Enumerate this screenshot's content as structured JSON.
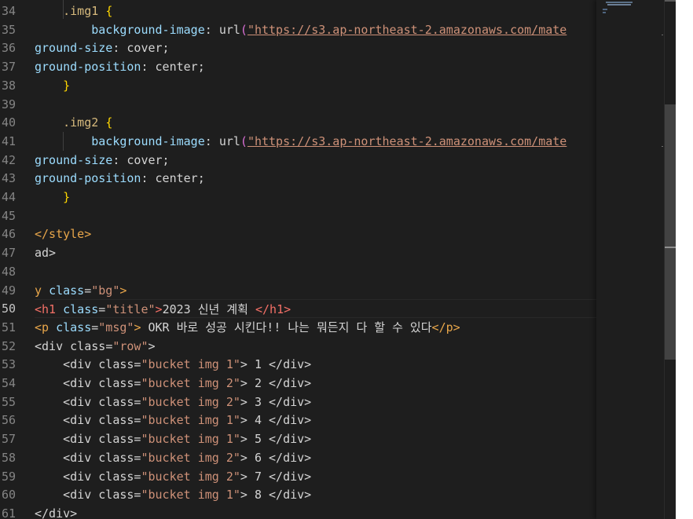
{
  "editor": {
    "language": "html",
    "active_line": "50",
    "colors": {
      "background": "#1e1e1e",
      "line_number": "#858585",
      "line_number_active": "#c6c6c6",
      "text": "#d4d4d4",
      "tag": "#808080",
      "tag_name": "#569cd6",
      "attribute": "#9cdcfe",
      "string": "#ce9178",
      "selector": "#d7ba7d",
      "style_tag": "#e8a64a",
      "paren": "#da70d6",
      "brace": "#ffd700"
    },
    "lines": [
      {
        "num": "34",
        "tokens": [
          {
            "t": "    .img1 ",
            "c": "selector"
          },
          {
            "t": "{",
            "c": "brace"
          }
        ]
      },
      {
        "num": "35",
        "tokens": [
          {
            "t": "        ",
            "c": "text"
          },
          {
            "t": "background-image",
            "c": "attribute"
          },
          {
            "t": ": ",
            "c": "text"
          },
          {
            "t": "url",
            "c": "text"
          },
          {
            "t": "(",
            "c": "paren"
          },
          {
            "t": "\"https://s3.ap-northeast-2.amazonaws.com/mate",
            "c": "string",
            "u": true
          }
        ]
      },
      {
        "num": "36",
        "tokens": [
          {
            "t": "ground-size",
            "c": "attribute"
          },
          {
            "t": ": cover;",
            "c": "text"
          }
        ]
      },
      {
        "num": "37",
        "tokens": [
          {
            "t": "ground-position",
            "c": "attribute"
          },
          {
            "t": ": center;",
            "c": "text"
          }
        ]
      },
      {
        "num": "38",
        "tokens": [
          {
            "t": "    ",
            "c": "text"
          },
          {
            "t": "}",
            "c": "brace"
          }
        ]
      },
      {
        "num": "39",
        "tokens": []
      },
      {
        "num": "40",
        "tokens": [
          {
            "t": "    .img2 ",
            "c": "selector"
          },
          {
            "t": "{",
            "c": "brace"
          }
        ]
      },
      {
        "num": "41",
        "tokens": [
          {
            "t": "        ",
            "c": "text"
          },
          {
            "t": "background-image",
            "c": "attribute"
          },
          {
            "t": ": ",
            "c": "text"
          },
          {
            "t": "url",
            "c": "text"
          },
          {
            "t": "(",
            "c": "paren"
          },
          {
            "t": "\"https://s3.ap-northeast-2.amazonaws.com/mate",
            "c": "string",
            "u": true
          }
        ]
      },
      {
        "num": "42",
        "tokens": [
          {
            "t": "ground-size",
            "c": "attribute"
          },
          {
            "t": ": cover;",
            "c": "text"
          }
        ]
      },
      {
        "num": "43",
        "tokens": [
          {
            "t": "ground-position",
            "c": "attribute"
          },
          {
            "t": ": center;",
            "c": "text"
          }
        ]
      },
      {
        "num": "44",
        "tokens": [
          {
            "t": "    ",
            "c": "text"
          },
          {
            "t": "}",
            "c": "brace"
          }
        ]
      },
      {
        "num": "45",
        "tokens": []
      },
      {
        "num": "46",
        "tokens": [
          {
            "t": "</style>",
            "c": "style_tag"
          }
        ]
      },
      {
        "num": "47",
        "tokens": [
          {
            "t": "ad>",
            "c": "text"
          }
        ]
      },
      {
        "num": "48",
        "tokens": []
      },
      {
        "num": "49",
        "tokens": [
          {
            "t": "y ",
            "c": "style_tag"
          },
          {
            "t": "class",
            "c": "attribute"
          },
          {
            "t": "=",
            "c": "text"
          },
          {
            "t": "\"bg\"",
            "c": "string"
          },
          {
            "t": ">",
            "c": "style_tag"
          }
        ]
      },
      {
        "num": "50",
        "tokens": [
          {
            "t": "<h1 ",
            "c": "tag_red"
          },
          {
            "t": "class",
            "c": "attribute_red"
          },
          {
            "t": "=",
            "c": "text"
          },
          {
            "t": "\"title\"",
            "c": "string"
          },
          {
            "t": ">",
            "c": "tag_red"
          },
          {
            "t": "2023 신년 계획 ",
            "c": "text"
          },
          {
            "t": "</h1>",
            "c": "tag_red"
          }
        ]
      },
      {
        "num": "51",
        "tokens": [
          {
            "t": "<p ",
            "c": "style_tag"
          },
          {
            "t": "class",
            "c": "attribute"
          },
          {
            "t": "=",
            "c": "text"
          },
          {
            "t": "\"msg\"",
            "c": "string"
          },
          {
            "t": ">",
            "c": "style_tag"
          },
          {
            "t": " OKR 바로 성공 시킨다!! 나는 뭐든지 다 할 수 있다",
            "c": "text"
          },
          {
            "t": "</p>",
            "c": "style_tag"
          }
        ]
      },
      {
        "num": "52",
        "tokens": [
          {
            "t": "<div ",
            "c": "text"
          },
          {
            "t": "class",
            "c": "text"
          },
          {
            "t": "=",
            "c": "text"
          },
          {
            "t": "\"row\"",
            "c": "string"
          },
          {
            "t": ">",
            "c": "text"
          }
        ]
      },
      {
        "num": "53",
        "tokens": [
          {
            "t": "    <div class=",
            "c": "text"
          },
          {
            "t": "\"bucket img 1\"",
            "c": "string"
          },
          {
            "t": "> 1 </div>",
            "c": "text"
          }
        ]
      },
      {
        "num": "54",
        "tokens": [
          {
            "t": "    <div class=",
            "c": "text"
          },
          {
            "t": "\"bucket img 2\"",
            "c": "string"
          },
          {
            "t": "> 2 </div>",
            "c": "text"
          }
        ]
      },
      {
        "num": "55",
        "tokens": [
          {
            "t": "    <div class=",
            "c": "text"
          },
          {
            "t": "\"bucket img 2\"",
            "c": "string"
          },
          {
            "t": "> 3 </div>",
            "c": "text"
          }
        ]
      },
      {
        "num": "56",
        "tokens": [
          {
            "t": "    <div class=",
            "c": "text"
          },
          {
            "t": "\"bucket img 1\"",
            "c": "string"
          },
          {
            "t": "> 4 </div>",
            "c": "text"
          }
        ]
      },
      {
        "num": "57",
        "tokens": [
          {
            "t": "    <div class=",
            "c": "text"
          },
          {
            "t": "\"bucket img 1\"",
            "c": "string"
          },
          {
            "t": "> 5 </div>",
            "c": "text"
          }
        ]
      },
      {
        "num": "58",
        "tokens": [
          {
            "t": "    <div class=",
            "c": "text"
          },
          {
            "t": "\"bucket img 2\"",
            "c": "string"
          },
          {
            "t": "> 6 </div>",
            "c": "text"
          }
        ]
      },
      {
        "num": "59",
        "tokens": [
          {
            "t": "    <div class=",
            "c": "text"
          },
          {
            "t": "\"bucket img 2\"",
            "c": "string"
          },
          {
            "t": "> 7 </div>",
            "c": "text"
          }
        ]
      },
      {
        "num": "60",
        "tokens": [
          {
            "t": "    <div class=",
            "c": "text"
          },
          {
            "t": "\"bucket img 1\"",
            "c": "string"
          },
          {
            "t": "> 8 </div>",
            "c": "text"
          }
        ]
      },
      {
        "num": "61",
        "tokens": [
          {
            "t": "</div>",
            "c": "text"
          }
        ]
      }
    ]
  }
}
